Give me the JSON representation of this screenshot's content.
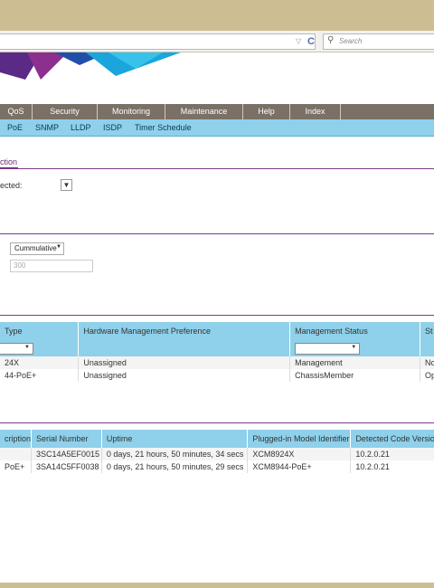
{
  "browser": {
    "search_placeholder": "Search",
    "reload_glyph": "C",
    "funnel_glyph": "▽"
  },
  "menu": [
    "QoS",
    "Security",
    "Monitoring",
    "Maintenance",
    "Help",
    "Index"
  ],
  "submenu": [
    "PoE",
    "SNMP",
    "LLDP",
    "ISDP",
    "Timer Schedule"
  ],
  "section_tab": "ction",
  "detected_label": "ected:",
  "counter": {
    "mode": "Cummulative",
    "interval": "300"
  },
  "units_table": {
    "headers": [
      "Type",
      "Hardware Management Preference",
      "Management Status",
      "St"
    ],
    "rows": [
      [
        "24X",
        "Unassigned",
        "Management",
        "No"
      ],
      [
        "44-PoE+",
        "Unassigned",
        "ChassisMember",
        "Op"
      ]
    ]
  },
  "detail_table": {
    "headers": [
      "cription",
      "Serial Number",
      "Uptime",
      "Plugged-in Model Identifier",
      "Detected Code Version"
    ],
    "rows": [
      [
        "",
        "3SC14A5EF0015",
        "0 days, 21 hours, 50 minutes, 34 secs",
        "XCM8924X",
        "10.2.0.21"
      ],
      [
        "PoE+",
        "3SA14C5FF0038",
        "0 days, 21 hours, 50 minutes, 29 secs",
        "XCM8944-PoE+",
        "10.2.0.21"
      ]
    ]
  },
  "colors": {
    "menu_bg": "#7a7066",
    "submenu_bg": "#8fd0ea",
    "accent_purple": "#7a3c88",
    "frame": "#cdbd92"
  },
  "icons": {
    "search": "search-icon",
    "filter": "filter-icon",
    "reload": "reload-icon"
  }
}
